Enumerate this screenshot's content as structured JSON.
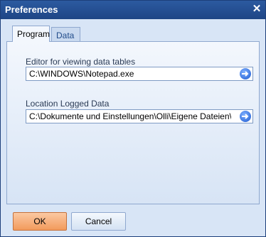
{
  "window": {
    "title": "Preferences",
    "close_symbol": "✕"
  },
  "tabs": [
    {
      "label": "Program",
      "active": true
    },
    {
      "label": "Data",
      "active": false
    }
  ],
  "fields": {
    "editor": {
      "label": "Editor for viewing data tables",
      "value": "C:\\WINDOWS\\Notepad.exe",
      "button_icon": "browse-arrow-icon"
    },
    "logged": {
      "label": "Location Logged Data",
      "value": "C:\\Dokumente und Einstellungen\\Olli\\Eigene Dateien\\Yoyo",
      "button_icon": "browse-arrow-icon"
    }
  },
  "buttons": {
    "ok": "OK",
    "cancel": "Cancel"
  },
  "colors": {
    "title_bar": "#2c5aa0",
    "ok_button": "#f29a5c",
    "panel": "#f3f7fd"
  }
}
